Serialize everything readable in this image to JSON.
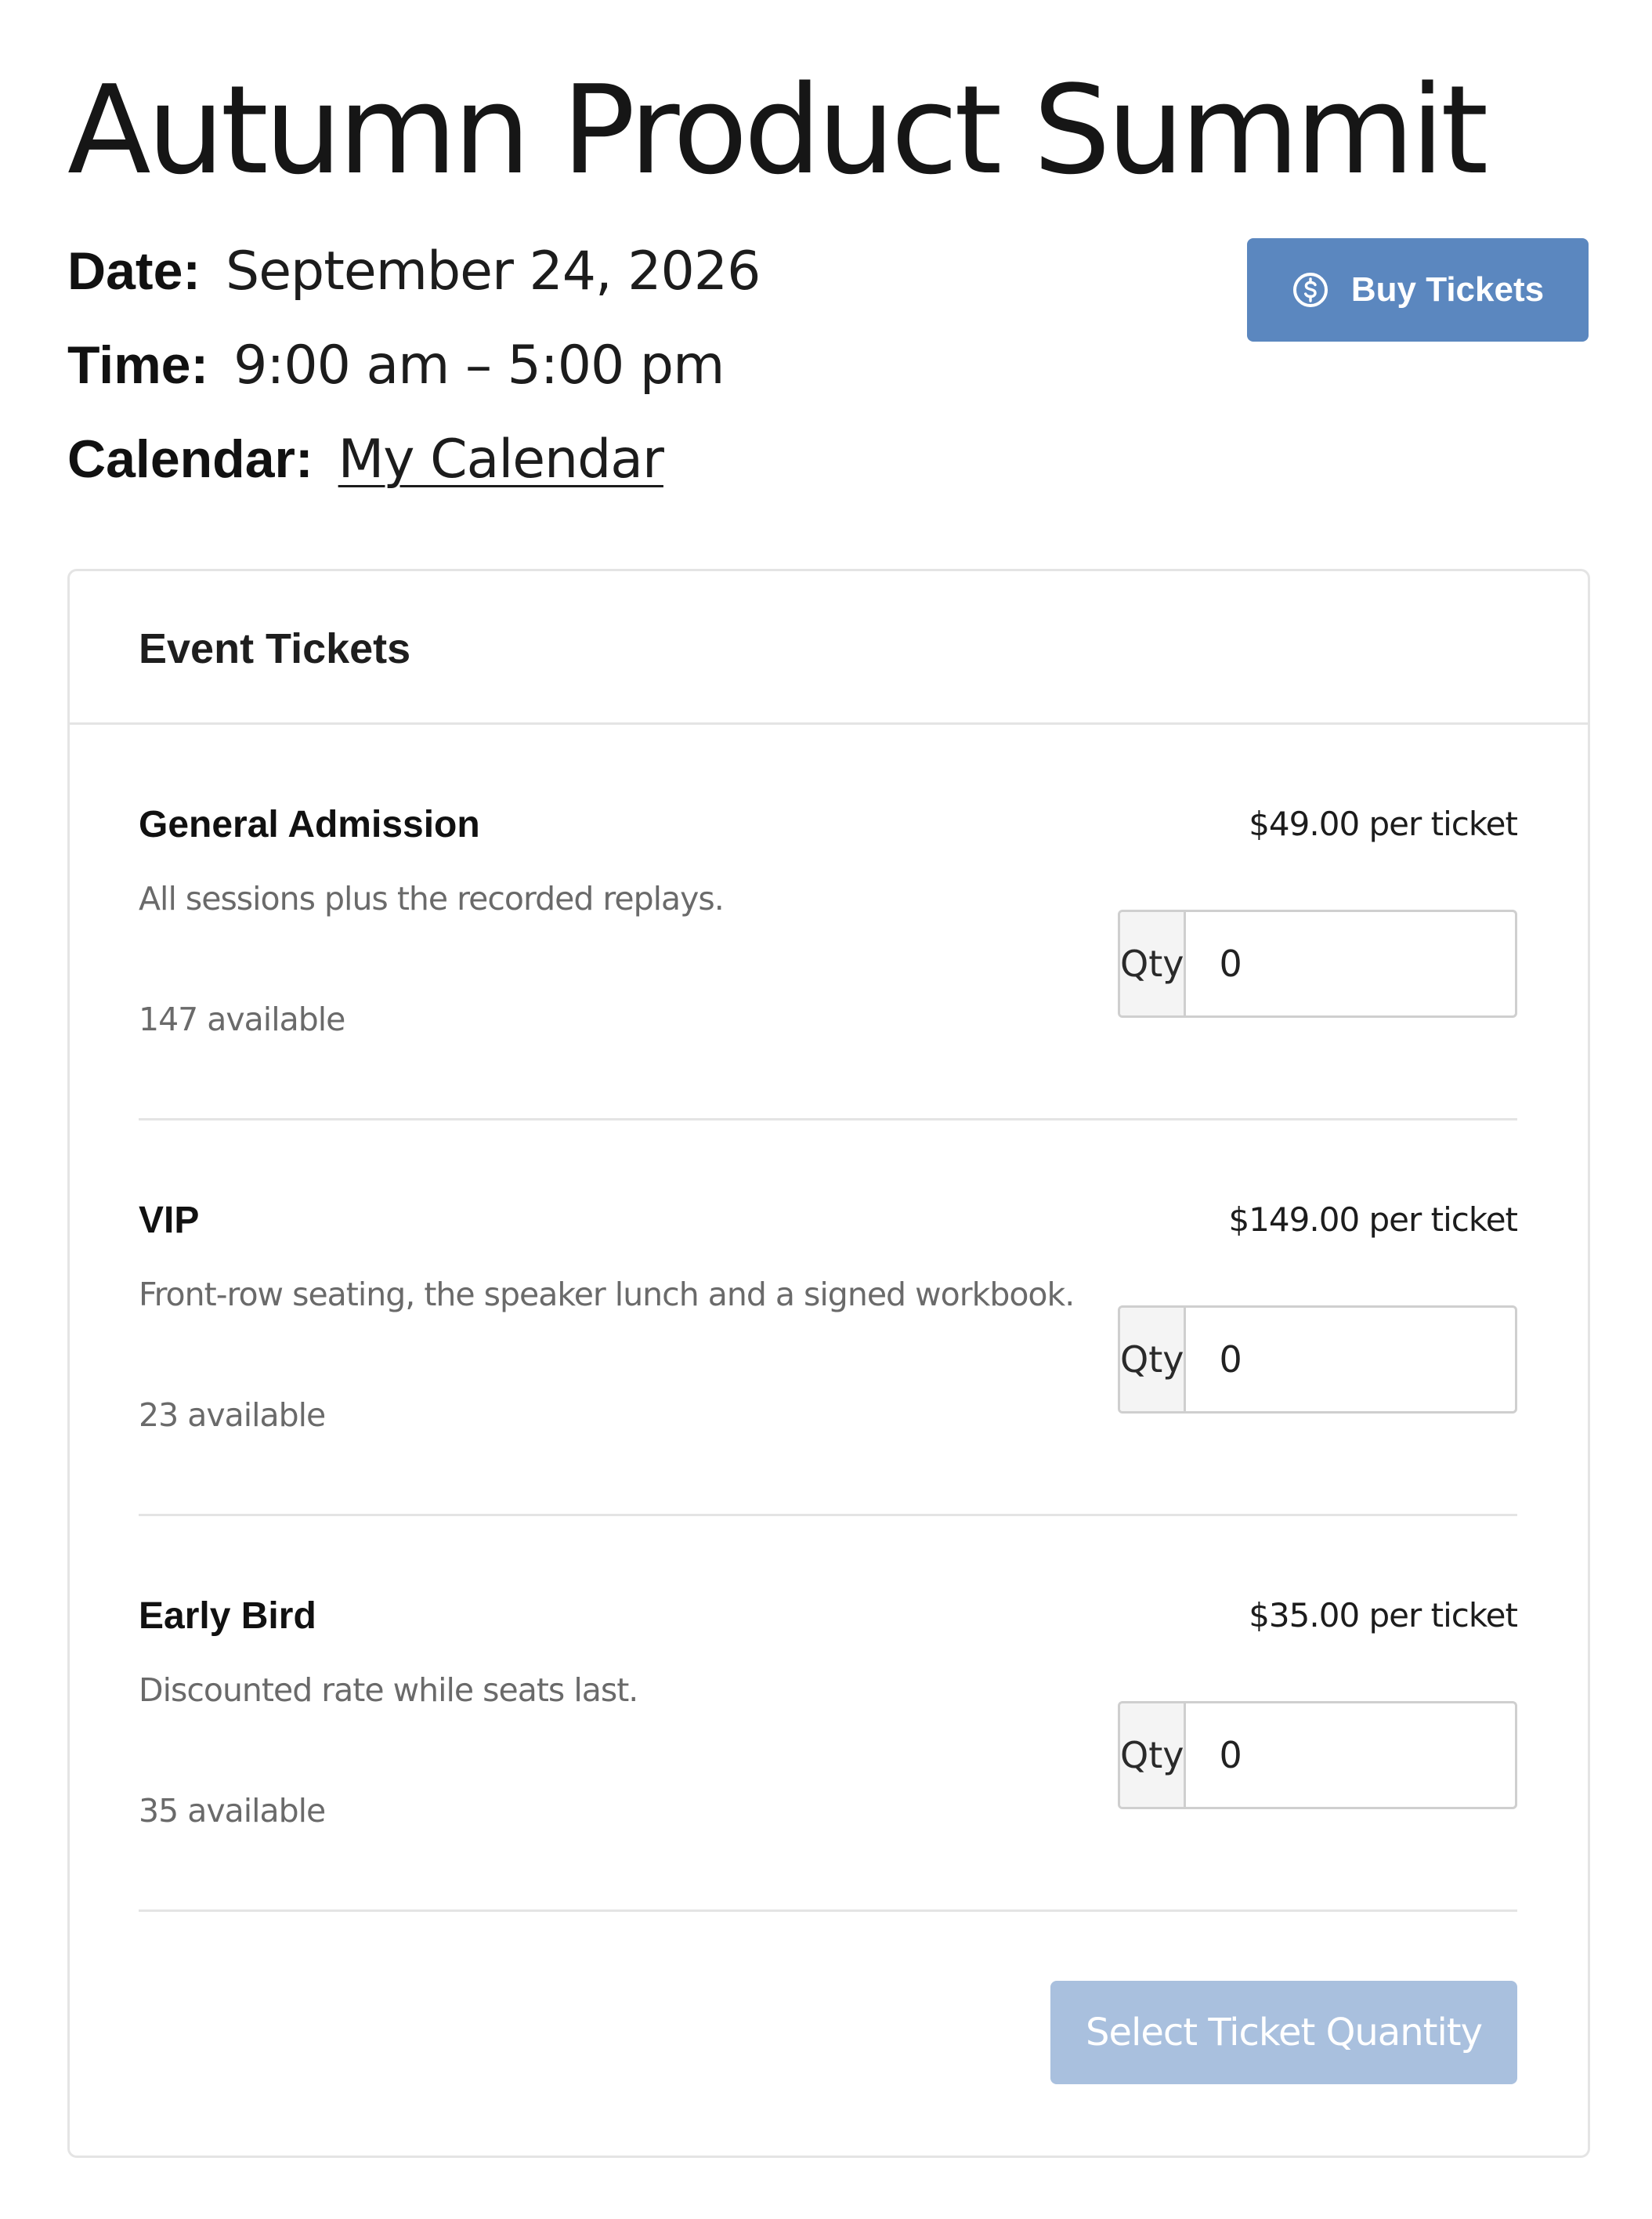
{
  "event": {
    "title": "Autumn Product Summit",
    "date_label": "Date:",
    "date": "September 24, 2026",
    "time_label": "Time:",
    "time": "9:00 am – 5:00 pm",
    "calendar_label": "Calendar:",
    "calendar_link": "My Calendar"
  },
  "buy_button": {
    "label": "Buy Tickets",
    "icon": "dollar-coin-icon",
    "color": "#5b87bf"
  },
  "tickets_panel": {
    "heading": "Event Tickets",
    "qty_label": "Qty",
    "tickets": [
      {
        "name": "General Admission",
        "price": "$49.00 per ticket",
        "description": "All sessions plus the recorded replays.",
        "availability": "147 available",
        "qty": "0"
      },
      {
        "name": "VIP",
        "price": "$149.00 per ticket",
        "description": "Front-row seating, the speaker lunch and a signed workbook.",
        "availability": "23 available",
        "qty": "0"
      },
      {
        "name": "Early Bird",
        "price": "$35.00 per ticket",
        "description": "Discounted rate while seats last.",
        "availability": "35 available",
        "qty": "0"
      }
    ],
    "submit_label": "Select Ticket Quantity",
    "submit_color": "#a9c0de"
  }
}
